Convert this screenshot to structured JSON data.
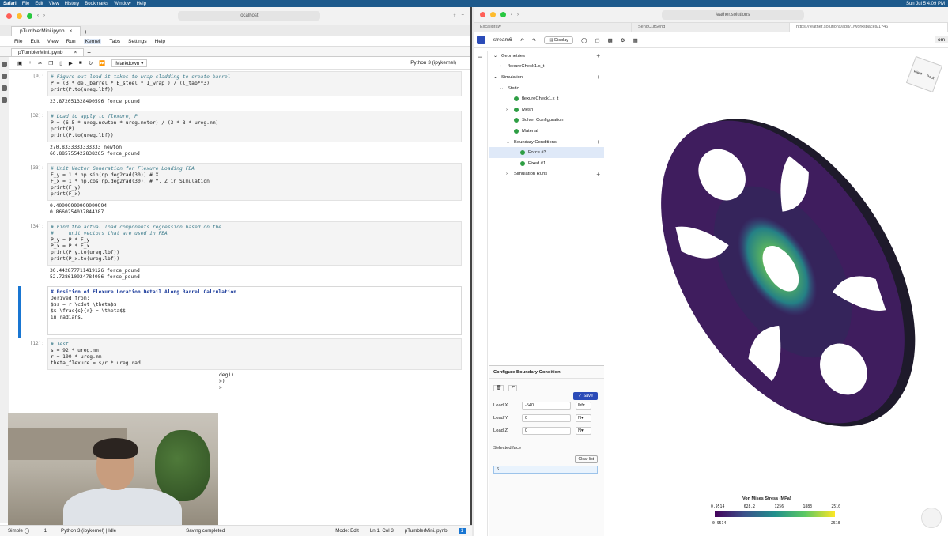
{
  "menubar": {
    "app": "Safari",
    "items": [
      "File",
      "Edit",
      "View",
      "History",
      "Bookmarks",
      "Window",
      "Help"
    ],
    "clock": "Sun Jul 5  4:09 PM"
  },
  "left": {
    "url": "localhost",
    "browser_tab": "pTumblerMini.ipynb",
    "menu": [
      "File",
      "Edit",
      "View",
      "Run",
      "Kernel",
      "Tabs",
      "Settings",
      "Help"
    ],
    "nb_tab": "pTumblerMini.ipynb",
    "cell_type": "Markdown",
    "kernel": "Python 3 (ipykernel)",
    "cells": [
      {
        "prompt": "[9]:",
        "code": [
          "# Figure out load it takes to wrap cladding to create barrel",
          "P = (3 * del_barrel * E_steel * I_wrap ) / (l_tab**3)",
          "print(P.to(ureg.lbf))"
        ],
        "output": [
          "23.872051328490596 force_pound"
        ]
      },
      {
        "prompt": "[32]:",
        "code": [
          "# Load to apply to flexure, P",
          "P = (6.5 * ureg.newton * ureg.meter) / (3 * 8 * ureg.mm)",
          "",
          "print(P)",
          "print(P.to(ureg.lbf))"
        ],
        "output": [
          "270.8333333333333 newton",
          "60.885755422838265 force_pound"
        ]
      },
      {
        "prompt": "[33]:",
        "code": [
          "# Unit Vector Generation for Flexure Loading FEA",
          "F_y = 1 * np.sin(np.deg2rad(30)) # X",
          "F_x = 1 * np.cos(np.deg2rad(30)) # Y, Z in Simulation",
          "",
          "print(F_y)",
          "print(F_x)"
        ],
        "output": [
          "0.49999999999999994",
          "0.8660254037844387"
        ]
      },
      {
        "prompt": "[34]:",
        "code": [
          "# Find the actual load components regression based on the",
          "#     unit vectors that are used in FEA",
          "P_y = P * F_y",
          "P_x = P * F_x",
          "",
          "print(P_y.to(ureg.lbf))",
          "print(P_x.to(ureg.lbf))"
        ],
        "output": [
          "30.442877711419126 force_pound",
          "52.728610924784086 force_pound"
        ]
      }
    ],
    "markdown": [
      "# Position of Flexure Location Detail Along Barrel Calculation",
      "Derived from:",
      "$$s = r \\cdot \\theta$$",
      "$$ \\frac{s}{r} = \\theta$$",
      "",
      "in radians."
    ],
    "test_cell": {
      "prompt": "[12]:",
      "code": [
        "# Test",
        "s = 92 * ureg.mm",
        "r = 100 * ureg.mm",
        "theta_flexure = s/r * ureg.rad"
      ]
    },
    "hidden_tail": [
      "deg))",
      ">)",
      ">"
    ],
    "status": {
      "mode": "Simple",
      "count": "1",
      "kernel": "Python 3 (ipykernel) | Idle",
      "saving": "Saving completed",
      "edit": "Mode: Edit",
      "lncol": "Ln 1, Col 3",
      "file": "pTumblerMini.ipynb",
      "badge": "1"
    }
  },
  "right": {
    "url": "feather.solutions",
    "tabs": [
      "Excalidraw",
      "SendCutSend",
      "https://feather.solutions/app/1/workspaces/1?46"
    ],
    "stream": "stream6",
    "display": "Display",
    "user": "om",
    "tree": [
      {
        "label": "Geometries",
        "indent": 0,
        "plus": true,
        "chev": "v",
        "check": false
      },
      {
        "label": "flexureCheck1.x_t",
        "indent": 1,
        "plus": false,
        "chev": ">",
        "check": false
      },
      {
        "label": "Simulation",
        "indent": 0,
        "plus": true,
        "chev": "v",
        "check": false
      },
      {
        "label": "Static",
        "indent": 1,
        "plus": false,
        "chev": "v",
        "check": false
      },
      {
        "label": "flexureCheck1.x_t",
        "indent": 2,
        "plus": false,
        "chev": "",
        "check": true
      },
      {
        "label": "Mesh",
        "indent": 2,
        "plus": false,
        "chev": ">",
        "check": true
      },
      {
        "label": "Solver Configuration",
        "indent": 2,
        "plus": false,
        "chev": "",
        "check": true
      },
      {
        "label": "Material",
        "indent": 2,
        "plus": false,
        "chev": "",
        "check": true
      },
      {
        "label": "Boundary Conditions",
        "indent": 2,
        "plus": true,
        "chev": "v",
        "check": false
      },
      {
        "label": "Force #3",
        "indent": 3,
        "plus": false,
        "chev": "",
        "check": true,
        "selected": true
      },
      {
        "label": "Fixed #1",
        "indent": 3,
        "plus": false,
        "chev": "",
        "check": true
      },
      {
        "label": "Simulation Runs",
        "indent": 2,
        "plus": true,
        "chev": ">",
        "check": false
      }
    ],
    "bc": {
      "title": "Configure Boundary Condition",
      "save": "Save",
      "load_x_label": "Load X",
      "load_x": "-540",
      "load_x_unit": "lbf",
      "load_y_label": "Load Y",
      "load_y": "0",
      "load_y_unit": "N",
      "load_z_label": "Load Z",
      "load_z": "0",
      "load_z_unit": "N",
      "selected_face_label": "Selected face",
      "clear": "Clear list",
      "face": "6"
    },
    "legend": {
      "title": "Von Mises Stress (MPa)",
      "ticks": [
        "0.9514",
        "628.2",
        "1256",
        "1883",
        "2510"
      ],
      "min": "0.9514",
      "max": "2510"
    },
    "viewcube": {
      "left": "Right",
      "right": "Back"
    },
    "colors": {
      "accent": "#2b4bb8",
      "check": "#2e9e44",
      "selected": "#dfe9f8"
    }
  }
}
